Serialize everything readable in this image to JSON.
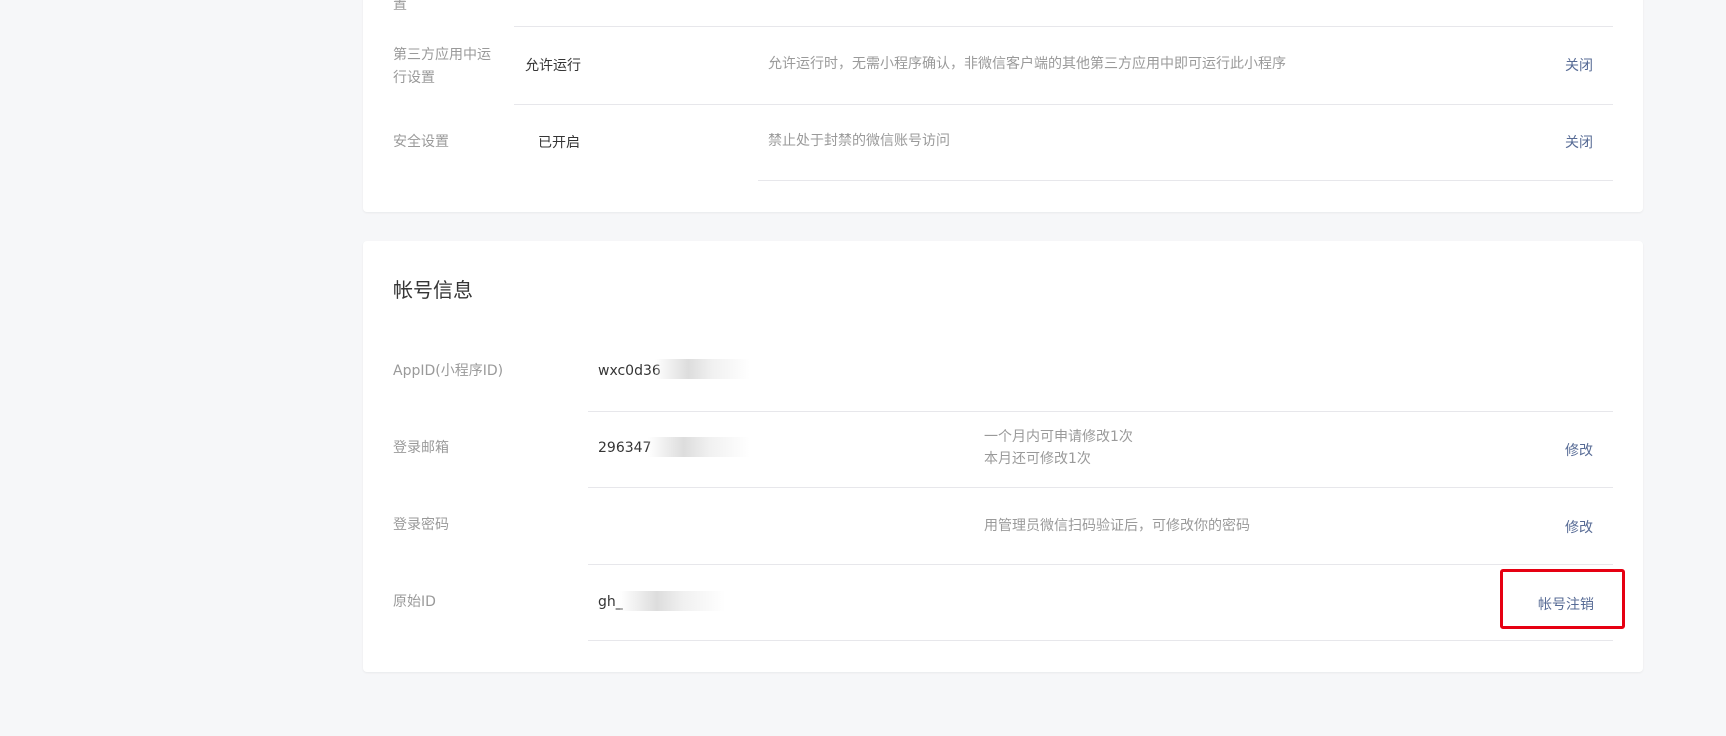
{
  "settings_card": {
    "partial_label": "置",
    "rows": [
      {
        "label": "第三方应用中运行设置",
        "label_line1": "第三方应用中运",
        "label_line2": "行设置",
        "value": "允许运行",
        "desc": "允许运行时，无需小程序确认，非微信客户端的其他第三方应用中即可运行此小程序",
        "action": "关闭"
      },
      {
        "label": "安全设置",
        "value": "已开启",
        "desc": "禁止处于封禁的微信账号访问",
        "action": "关闭"
      }
    ]
  },
  "account_card": {
    "title": "帐号信息",
    "rows": [
      {
        "label": "AppID(小程序ID)",
        "value": "wxc0d36",
        "masked": true
      },
      {
        "label": "登录邮箱",
        "value": "296347",
        "masked": true,
        "desc_line1": "一个月内可申请修改1次",
        "desc_line2": "本月还可修改1次",
        "action": "修改"
      },
      {
        "label": "登录密码",
        "desc": "用管理员微信扫码验证后，可修改你的密码",
        "action": "修改"
      },
      {
        "label": "原始ID",
        "value": "gh_",
        "masked": true,
        "action": "帐号注销",
        "action_highlighted": true
      }
    ]
  },
  "colors": {
    "page_bg": "#f6f7f9",
    "card_bg": "#ffffff",
    "link": "#576b95",
    "label": "#9a9a9a",
    "divider": "#e7e7eb",
    "highlight_border": "#e60012"
  }
}
